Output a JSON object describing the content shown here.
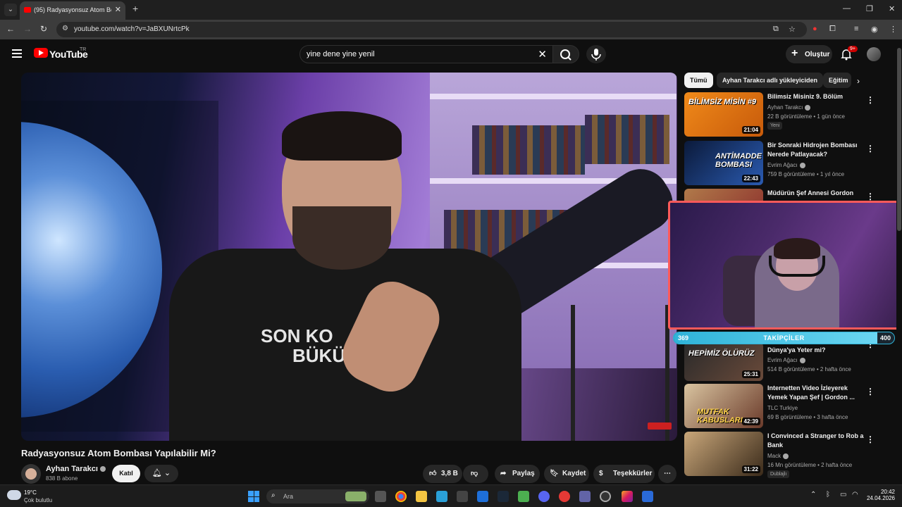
{
  "browser": {
    "tab_title": "(95) Radyasyonsuz Atom Bo",
    "url": "youtube.com/watch?v=JaBXUNrtcPk"
  },
  "youtube": {
    "logo_text": "YouTube",
    "country_code": "TR",
    "search_query": "yine dene yine yenil",
    "create_label": "Oluştur",
    "notif_count": "9+"
  },
  "video": {
    "title": "Radyasyonsuz Atom Bombası Yapılabilir Mi?",
    "shirt_text_line1": "SON KO",
    "shirt_text_line2": "BÜKÜ",
    "channel": "Ayhan Tarakcı",
    "subscribers": "838 B abone",
    "join_label": "Katıl",
    "likes": "3,8 B",
    "share_label": "Paylaş",
    "save_label": "Kaydet",
    "thanks_label": "Teşekkürler"
  },
  "chips": [
    "Tümü",
    "Ayhan Tarakcı adlı yükleyiciden",
    "Eğitim"
  ],
  "recommendations": [
    {
      "title": "Bilimsiz Misiniz 9. Bölüm",
      "channel": "Ayhan Tarakcı",
      "meta": "22 B görüntüleme • 1 gün önce",
      "badge": "Yeni",
      "duration": "21:04",
      "thumb_text": "BİLİMSİZ MİSİN #9"
    },
    {
      "title": "Bir Sonraki Hidrojen Bombası Nerede Patlayacak?",
      "channel": "Evrim Ağacı",
      "meta": "759 B görüntüleme • 1 yıl önce",
      "duration": "22:43",
      "thumb_text": "ANTİMADDE BOMBASI"
    },
    {
      "title": "Müdürün Şef Annesi Gordon",
      "channel": "",
      "meta": "",
      "duration": ""
    },
    {
      "title": "Dünya'ya Yeter mi?",
      "channel": "Evrim Ağacı",
      "meta": "514 B görüntüleme • 2 hafta önce",
      "duration": "25:31",
      "thumb_text": "HEPİMİZ ÖLÜRÜZ"
    },
    {
      "title": "Internetten Video İzleyerek Yemek Yapan Şef | Gordon ...",
      "channel": "TLC Turkiye",
      "meta": "69 B görüntüleme • 3 hafta önce",
      "duration": "42:39",
      "thumb_text": "MUTFAK KABUSLARI"
    },
    {
      "title": "I Convinced a Stranger to Rob a Bank",
      "channel": "Mack",
      "meta": "16 Mn görüntüleme • 2 hafta önce",
      "badge": "Dublajlı",
      "duration": "31:22"
    }
  ],
  "overlay": {
    "followers_label": "TAKİPÇİLER",
    "followers_current": "369",
    "followers_goal": "400",
    "follower_progress": 0.9225,
    "border_color": "#ff5a5a",
    "bar_color": "#2fb3d8"
  },
  "taskbar": {
    "temp": "19°C",
    "weather": "Çok bulutlu",
    "search_label": "Ara",
    "time": "20:42",
    "date": "24.04.2026"
  },
  "colors": {
    "brand": "#ff0000",
    "background": "#0f0f0f"
  }
}
